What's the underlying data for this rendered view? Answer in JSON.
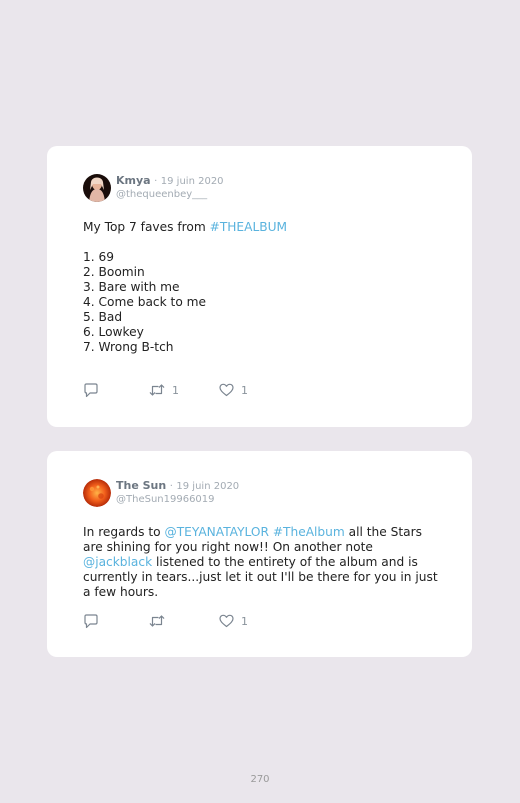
{
  "tweets": [
    {
      "name": "Kmya",
      "separator": "·",
      "date": "19 juin 2020",
      "handle": "@thequeenbey___",
      "intro_plain": "My Top 7 faves from ",
      "intro_tag": "#THEALBUM",
      "list": [
        "1. 69",
        "2. Boomin",
        "3. Bare with me",
        "4. Come back to me",
        "5. Bad",
        "6. Lowkey",
        "7. Wrong B-tch"
      ],
      "retweets": "1",
      "likes": "1"
    },
    {
      "name": "The Sun",
      "separator": "·",
      "date": "19 juin 2020",
      "handle": "@TheSun19966019",
      "text_1": "In regards to ",
      "mention_1": "@TEYANATAYLOR",
      "space": " ",
      "tag_1": "#TheAlbum",
      "text_2": " all the Stars are shining for you right now!! On another note ",
      "mention_2": "@jackblack",
      "text_3": " listened to the entirety of the album and is currently in tears...just let it out I'll be there for you in just a few hours.",
      "retweets": "",
      "likes": "1"
    }
  ],
  "page_number": "270",
  "colors": {
    "background": "#eae6ec",
    "card": "#ffffff",
    "link": "#5ab3de",
    "muted": "#a3abb3"
  },
  "icons": {
    "reply": "speech-bubble-icon",
    "retweet": "retweet-icon",
    "like": "heart-icon"
  }
}
